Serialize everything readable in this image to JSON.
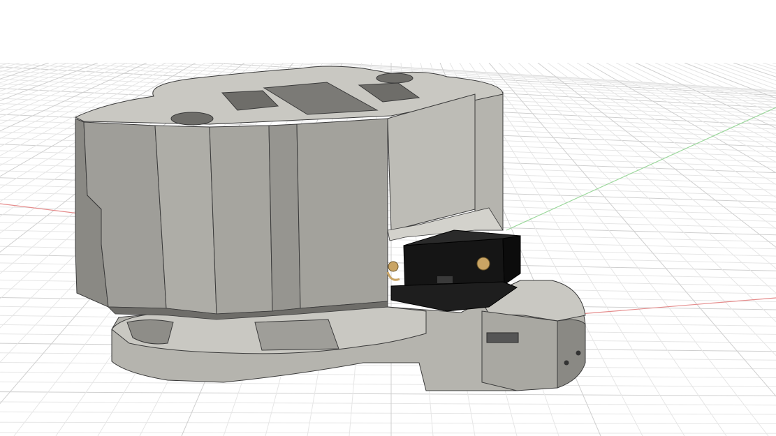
{
  "colors": {
    "background": "#ffffff",
    "grid_minor": "#e6e6e6",
    "grid_major": "#cfcfcf",
    "axis_x": "#e58c8c",
    "axis_y": "#9ad79a",
    "part_light": "#c9c8c2",
    "part_mid": "#9f9e99",
    "part_dark": "#7b7a76",
    "part_edge": "#3b3b3b",
    "connector_black": "#151515",
    "brass": "#c9a464"
  },
  "icons": {
    "model": "3d-model-icon"
  }
}
